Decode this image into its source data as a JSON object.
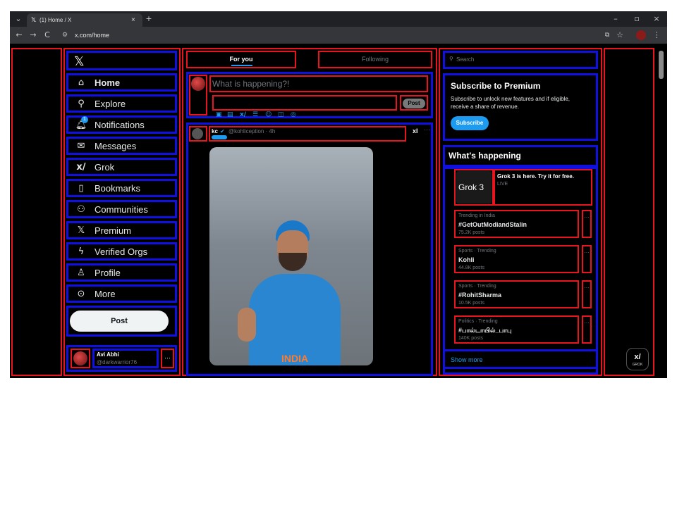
{
  "browser": {
    "tab_title": "(1) Home / X",
    "tab_close": "×",
    "new_tab": "+",
    "url": "x.com/home",
    "window_controls": [
      "–",
      "▫",
      "×"
    ],
    "nav": [
      "←",
      "→",
      "C"
    ]
  },
  "sidebar": {
    "logo": "𝕏",
    "items": [
      {
        "label": "Home",
        "icon": "home-icon"
      },
      {
        "label": "Explore",
        "icon": "search-icon"
      },
      {
        "label": "Notifications",
        "icon": "bell-icon"
      },
      {
        "label": "Messages",
        "icon": "envelope-icon"
      },
      {
        "label": "Grok",
        "icon": "grok-icon"
      },
      {
        "label": "Bookmarks",
        "icon": "bookmark-icon"
      },
      {
        "label": "Communities",
        "icon": "people-icon"
      },
      {
        "label": "Premium",
        "icon": "x-icon"
      },
      {
        "label": "Verified Orgs",
        "icon": "lightning-icon"
      },
      {
        "label": "Profile",
        "icon": "person-icon"
      },
      {
        "label": "More",
        "icon": "ellipsis-circle-icon"
      }
    ],
    "notification_badge": "1",
    "post_button": "Post",
    "account": {
      "name": "Avi Abhi",
      "handle": "@darkwarrior76",
      "more": "···"
    }
  },
  "feed": {
    "tabs": [
      "For you",
      "Following"
    ],
    "composer": {
      "placeholder": "What is happening?!",
      "post_button": "Post"
    },
    "tweet": {
      "author": "kc",
      "handle_time": "@kohliception · 4h",
      "grok_label": "xI",
      "more": "···",
      "jersey_text": "INDIA"
    }
  },
  "right": {
    "search_placeholder": "Search",
    "premium": {
      "title": "Subscribe to Premium",
      "body": "Subscribe to unlock new features and if eligible, receive a share of revenue.",
      "button": "Subscribe"
    },
    "whats_happening": "What's happening",
    "grok_promo": {
      "title": "Grok 3 is here. Try it for free.",
      "sub": "LIVE",
      "thumb_text": "Grok 3"
    },
    "trends": [
      {
        "category": "Trending in India",
        "title": "#GetOutModiandStalin",
        "posts": "75.2K posts"
      },
      {
        "category": "Sports · Trending",
        "title": "Kohli",
        "posts": "44.8K posts"
      },
      {
        "category": "Sports · Trending",
        "title": "#RohitSharma",
        "posts": "10.5K posts"
      },
      {
        "category": "Politics · Trending",
        "title": "#பால்டாயில்_பாபு",
        "posts": "140K posts"
      }
    ],
    "show_more": "Show more",
    "grok_float": "GROK"
  },
  "colors": {
    "accent": "#1d9bf0",
    "annotation_red": "#e8141e",
    "annotation_blue": "#1010e0"
  }
}
